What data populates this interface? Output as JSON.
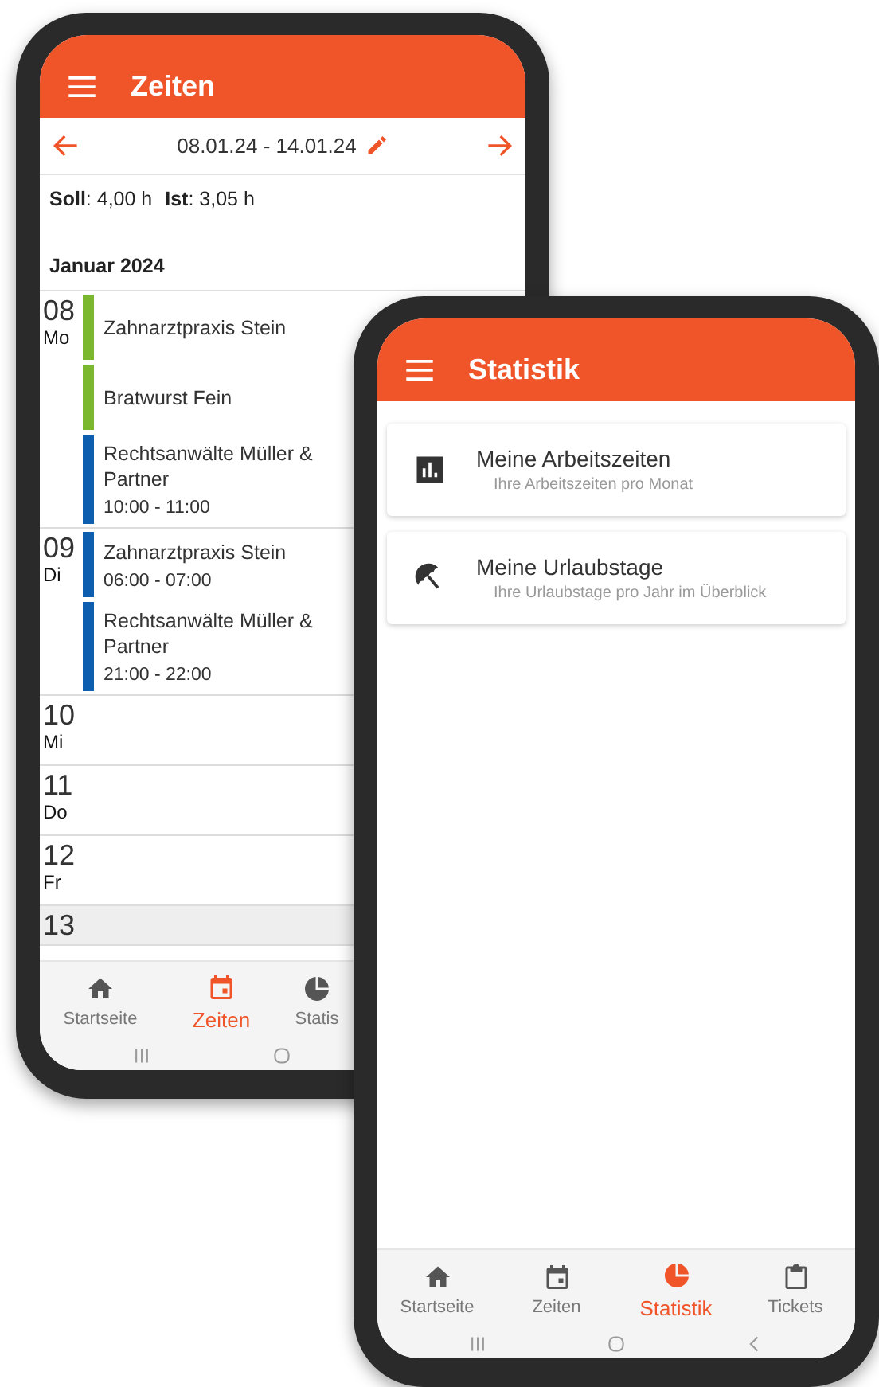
{
  "phone_zeiten": {
    "title": "Zeiten",
    "week_range": "08.01.24 - 14.01.24",
    "summary": [
      "**Soll**: 4,00 h",
      "**Ist**: 3,05 h"
    ],
    "month": "Januar 2024",
    "days": [
      {
        "day": "08",
        "weekday": "Mo",
        "highlighted": false,
        "entries": [
          {
            "name": "Zahnarztpraxis Stein",
            "color": "#7cb82f"
          },
          {
            "name": "Bratwurst Fein",
            "color": "#7cb82f"
          },
          {
            "name": "Rechtsanwälte Müller & Partner",
            "time": "10:00 - 11:00",
            "color": "#0d5eaf"
          }
        ]
      },
      {
        "day": "09",
        "weekday": "Di",
        "highlighted": false,
        "entries": [
          {
            "name": "Zahnarztpraxis Stein",
            "time": "06:00 - 07:00",
            "color": "#0d5eaf"
          },
          {
            "name": "Rechtsanwälte Müller & Partner",
            "time": "21:00 - 22:00",
            "color": "#0d5eaf"
          }
        ]
      },
      {
        "day": "10",
        "weekday": "Mi",
        "highlighted": false
      },
      {
        "day": "11",
        "weekday": "Do",
        "highlighted": false
      },
      {
        "day": "12",
        "weekday": "Fr",
        "highlighted": false
      },
      {
        "day": "13",
        "highlighted": true
      }
    ],
    "nav": [
      {
        "label": "Startseite",
        "selected": false
      },
      {
        "label": "Zeiten",
        "selected": true
      },
      {
        "label": "Statis",
        "selected": false
      }
    ]
  },
  "phone_statistik": {
    "title": "Statistik",
    "cards": [
      {
        "title": "Meine Arbeitszeiten",
        "subtitle": "Ihre Arbeitszeiten pro Monat"
      },
      {
        "title": "Meine Urlaubstage",
        "subtitle": "Ihre Urlaubstage pro Jahr im Überblick"
      }
    ],
    "nav": [
      {
        "label": "Startseite",
        "selected": false
      },
      {
        "label": "Zeiten",
        "selected": false
      },
      {
        "label": "Statistik",
        "selected": true
      },
      {
        "label": "Tickets",
        "selected": false
      }
    ]
  }
}
